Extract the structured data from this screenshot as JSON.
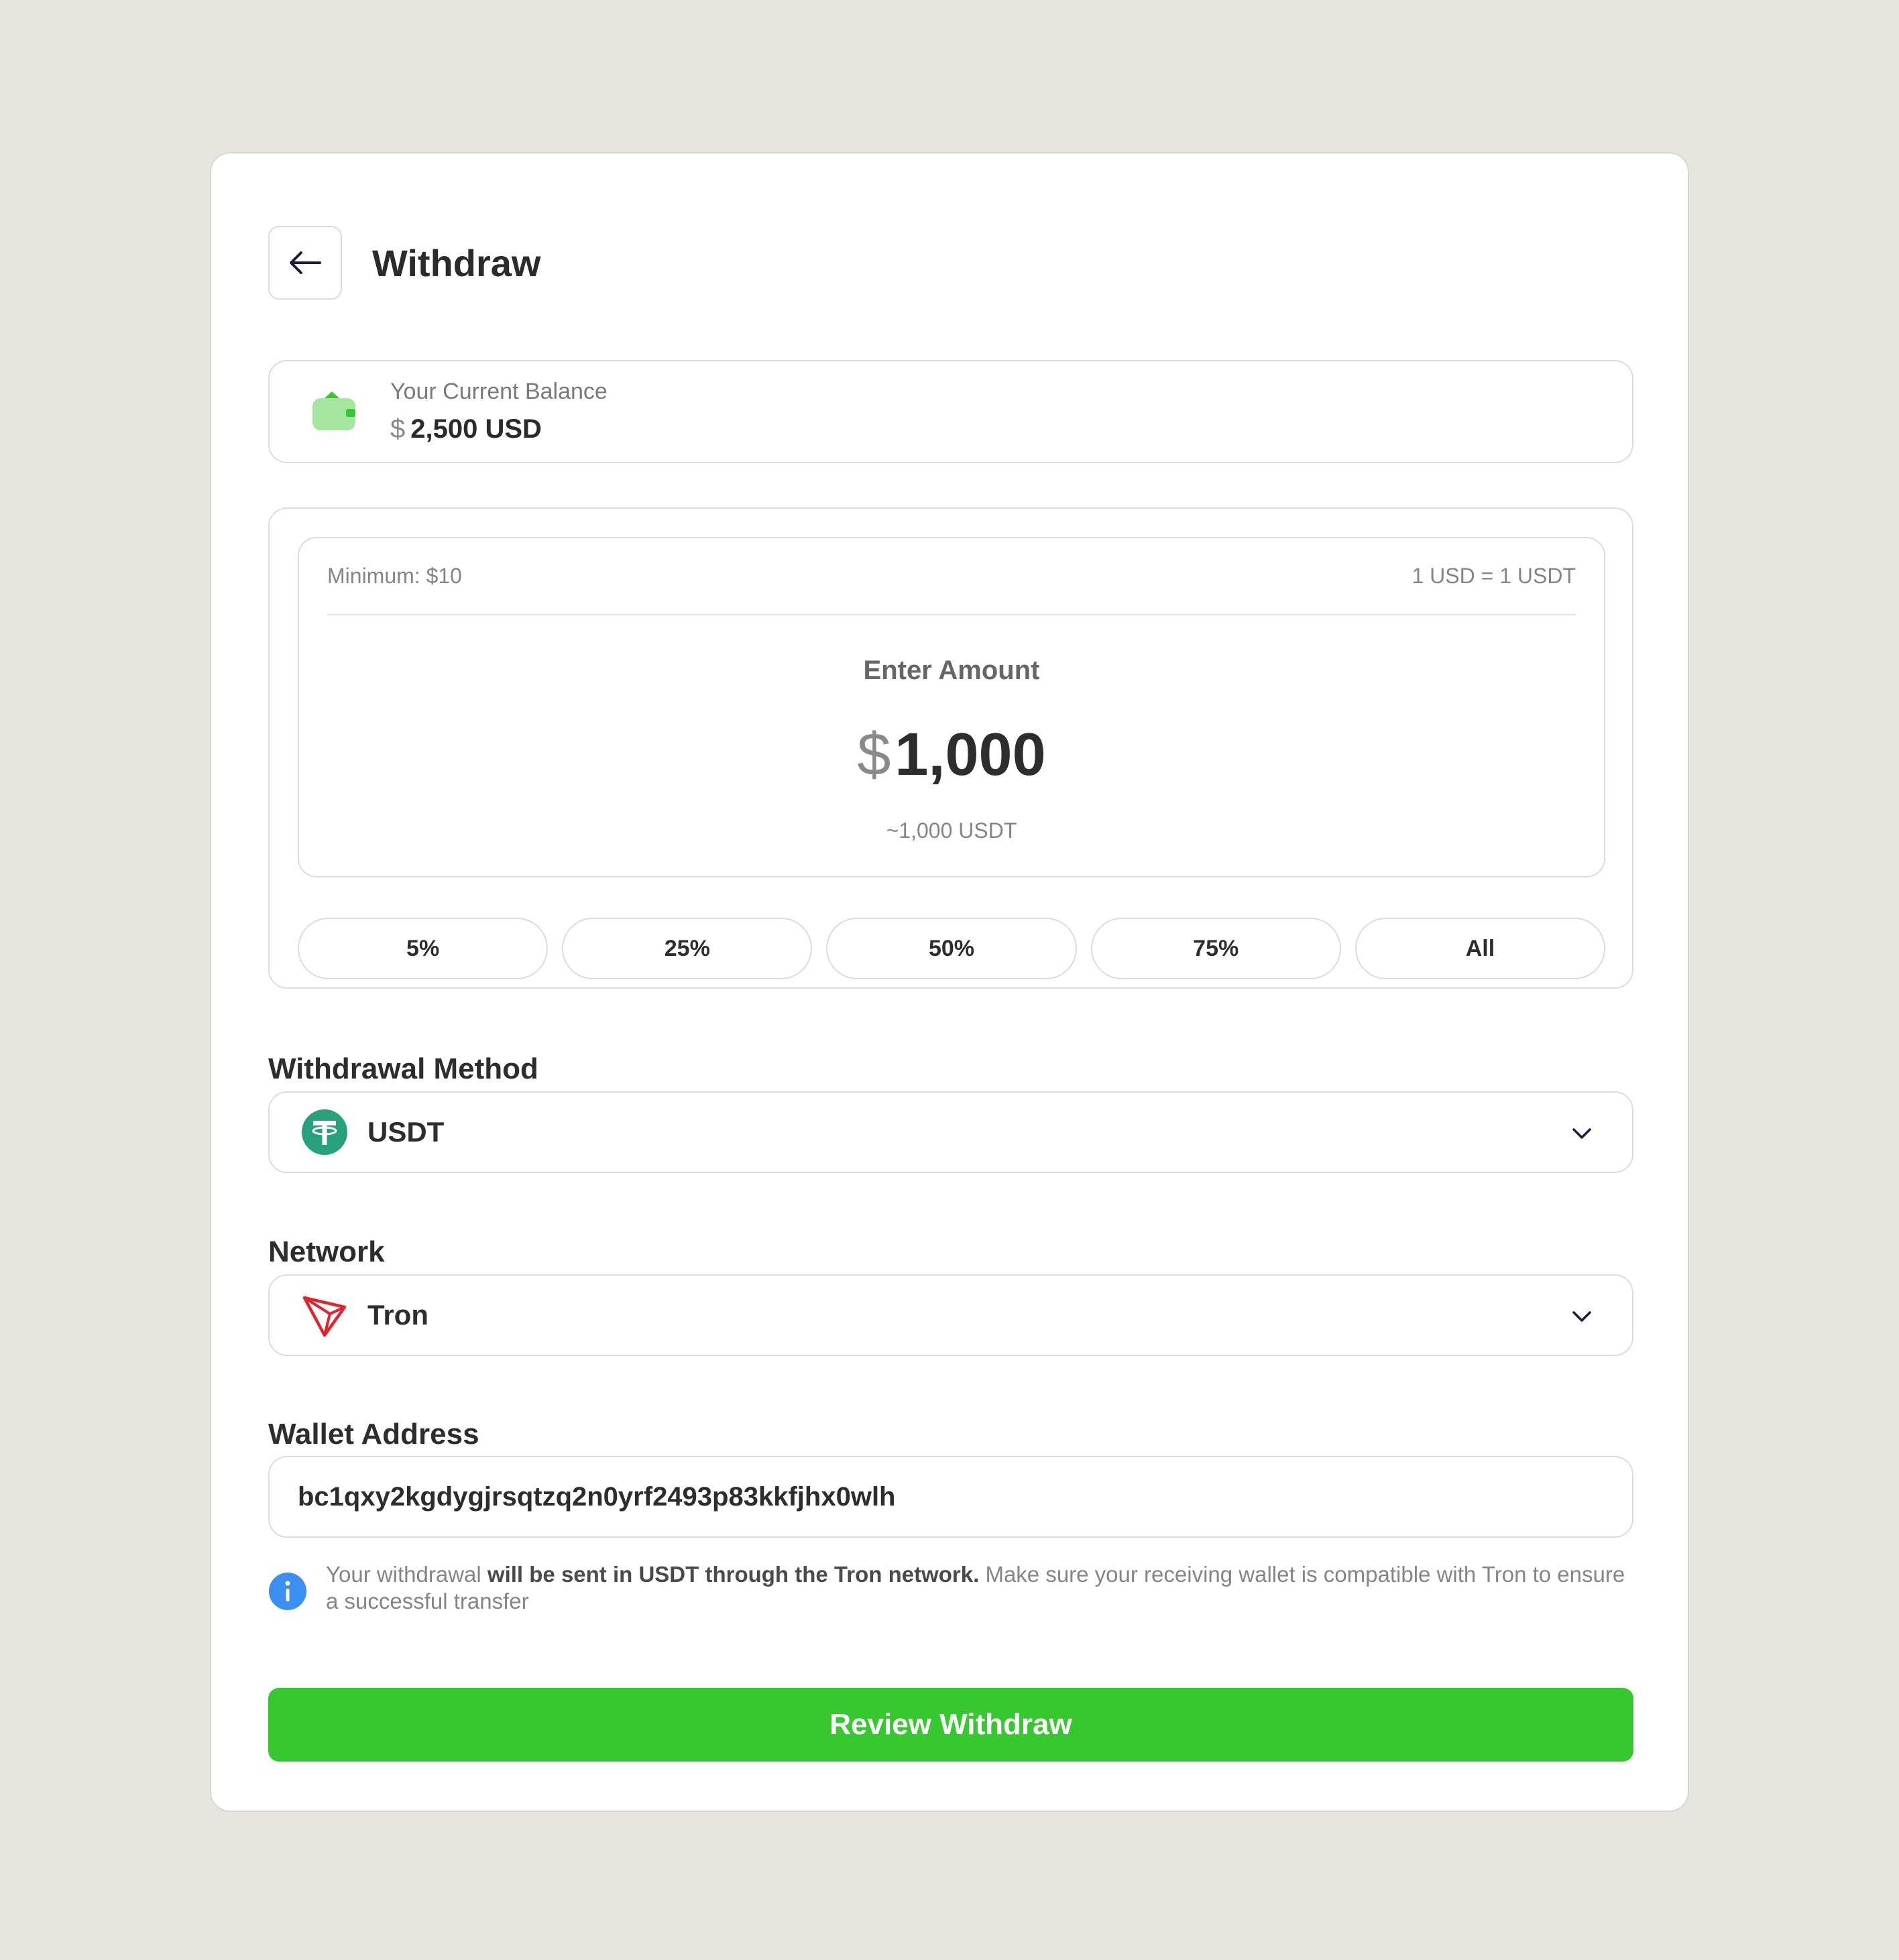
{
  "header": {
    "title": "Withdraw"
  },
  "balance": {
    "label": "Your Current Balance",
    "currency_symbol": "$",
    "value": "2,500 USD"
  },
  "amount": {
    "minimum": "Minimum: $10",
    "rate": "1 USD = 1 USDT",
    "label": "Enter Amount",
    "currency_symbol": "$",
    "value": "1,000",
    "approx": "~1,000 USDT",
    "percent_options": [
      "5%",
      "25%",
      "50%",
      "75%",
      "All"
    ]
  },
  "method": {
    "label": "Withdrawal Method",
    "value": "USDT",
    "icon": "tether-icon"
  },
  "network": {
    "label": "Network",
    "value": "Tron",
    "icon": "tron-icon"
  },
  "wallet": {
    "label": "Wallet Address",
    "value": "bc1qxy2kgdygjrsqtzq2n0yrf2493p83kkfjhx0wlh"
  },
  "info": {
    "prefix": "Your withdrawal ",
    "bold": "will be sent in USDT through the Tron network.",
    "suffix": " Make sure your receiving wallet is compatible with Tron to ensure a successful transfer"
  },
  "submit": {
    "label": "Review Withdraw"
  },
  "colors": {
    "accent": "#36c82e",
    "tether": "#26a17b",
    "tron": "#e3222b",
    "info": "#3b8ff0"
  }
}
